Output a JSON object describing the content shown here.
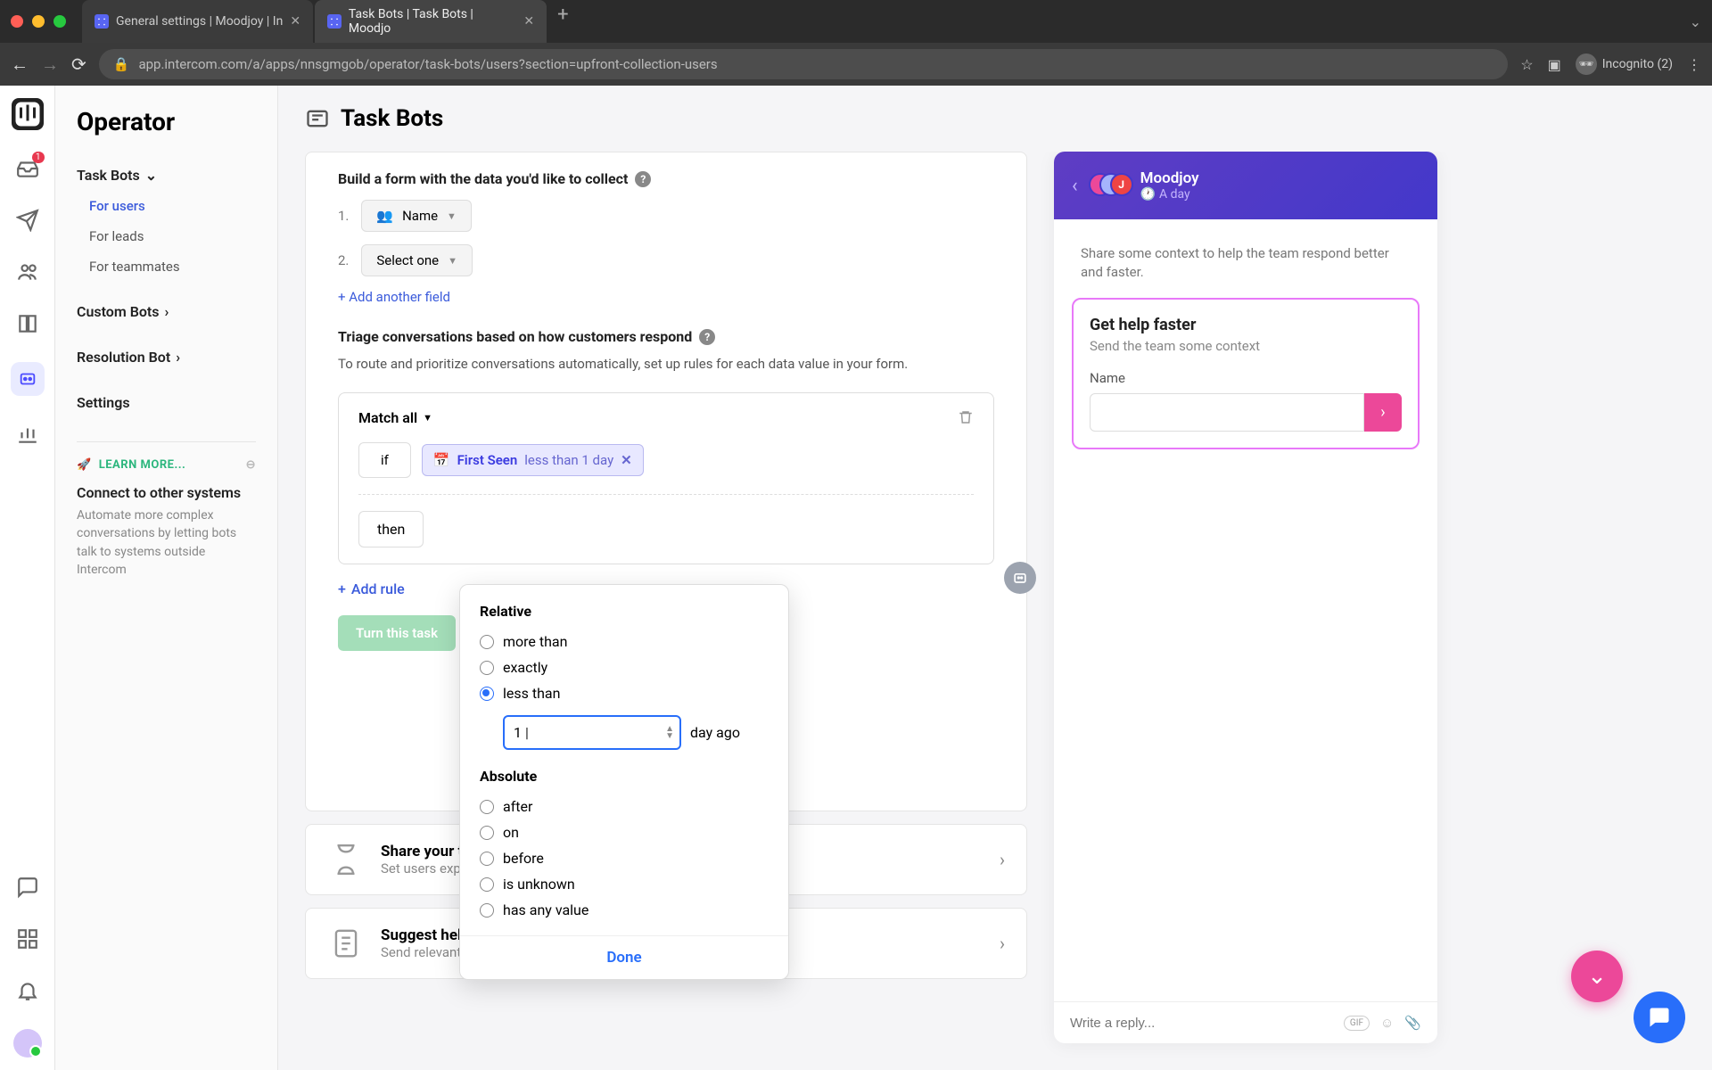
{
  "browser": {
    "tabs": [
      {
        "label": "General settings | Moodjoy | In"
      },
      {
        "label": "Task Bots | Task Bots | Moodjo"
      }
    ],
    "url": "app.intercom.com/a/apps/nnsgmgob/operator/task-bots/users?section=upfront-collection-users",
    "incognito_label": "Incognito (2)"
  },
  "rail": {
    "inbox_badge": "1"
  },
  "sidebar": {
    "title": "Operator",
    "nav": {
      "task_bots": {
        "label": "Task Bots",
        "children": {
          "for_users": "For users",
          "for_leads": "For leads",
          "for_teammates": "For teammates"
        }
      },
      "custom_bots": {
        "label": "Custom Bots"
      },
      "resolution_bot": {
        "label": "Resolution Bot"
      },
      "settings": {
        "label": "Settings"
      }
    },
    "learn_more": {
      "label": "LEARN MORE..."
    },
    "connect": {
      "title": "Connect to other systems",
      "desc": "Automate more complex conversations by letting bots talk to systems outside Intercom"
    }
  },
  "main": {
    "title": "Task Bots",
    "form": {
      "heading": "Build a form with the data you'd like to collect",
      "items": [
        "Name",
        "Select one"
      ],
      "add_field": "+ Add another field"
    },
    "triage": {
      "heading": "Triage conversations based on how customers respond",
      "desc": "To route and prioritize conversations automatically, set up rules for each data value in your form."
    },
    "rule": {
      "match_label": "Match all",
      "if_label": "if",
      "filter_attr": "First Seen",
      "filter_cond": "less than 1 day",
      "then_label": "then"
    },
    "add_rule": "Add rule",
    "turn_on": "Turn this task",
    "popover": {
      "group_relative": "Relative",
      "options_relative": {
        "more_than": "more than",
        "exactly": "exactly",
        "less_than": "less than"
      },
      "day_value": "1",
      "day_suffix": "day ago",
      "group_absolute": "Absolute",
      "options_absolute": {
        "after": "after",
        "on": "on",
        "before": "before",
        "unknown": "is unknown",
        "any": "has any value"
      },
      "done": "Done"
    },
    "collapsed": {
      "share": {
        "title": "Share your typ",
        "sub": "Set users expect"
      },
      "suggest": {
        "title": "Suggest help a",
        "sub": "Send relevant help articles"
      }
    }
  },
  "preview": {
    "brand": "Moodjoy",
    "time": "A day",
    "avatar_letter": "J",
    "context": "Share some context to help the team respond better and faster.",
    "card_title": "Get help faster",
    "card_sub": "Send the team some context",
    "field_label": "Name",
    "reply_placeholder": "Write a reply..."
  }
}
